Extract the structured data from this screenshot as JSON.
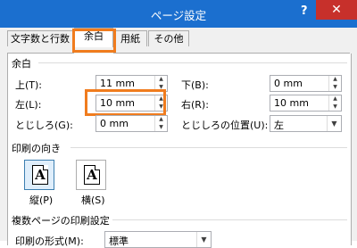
{
  "window": {
    "title": "ページ設定",
    "help": "?",
    "close": "✕"
  },
  "tabs": [
    {
      "label": "文字数と行数"
    },
    {
      "label": "余白"
    },
    {
      "label": "用紙"
    },
    {
      "label": "その他"
    }
  ],
  "margins": {
    "group_label": "余白",
    "top_label": "上(T):",
    "top_value": "11 mm",
    "bottom_label": "下(B):",
    "bottom_value": "0 mm",
    "left_label": "左(L):",
    "left_value": "10 mm",
    "right_label": "右(R):",
    "right_value": "10 mm",
    "gutter_label": "とじしろ(G):",
    "gutter_value": "0 mm",
    "gutter_pos_label": "とじしろの位置(U):",
    "gutter_pos_value": "左"
  },
  "orientation": {
    "group_label": "印刷の向き",
    "portrait_label": "縦(P)",
    "landscape_label": "横(S)",
    "icon_glyph": "A"
  },
  "multipage": {
    "group_label": "複数ページの印刷設定",
    "form_label": "印刷の形式(M):",
    "form_value": "標準"
  },
  "highlight_color": "#f07c1e"
}
